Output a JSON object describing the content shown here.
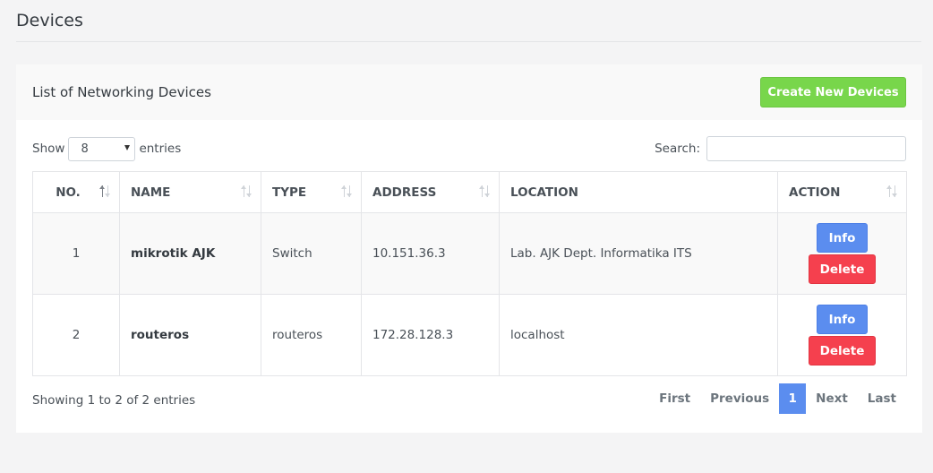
{
  "page": {
    "title": "Devices"
  },
  "card": {
    "title": "List of Networking Devices",
    "create_button": "Create New Devices"
  },
  "controls": {
    "show_label": "Show",
    "entries_value": "8",
    "entries_label": "entries",
    "search_label": "Search:",
    "search_value": ""
  },
  "table": {
    "headers": [
      "NO.",
      "NAME",
      "TYPE",
      "ADDRESS",
      "LOCATION",
      "ACTION"
    ],
    "rows": [
      {
        "no": "1",
        "name": "mikrotik AJK",
        "type": "Switch",
        "address": "10.151.36.3",
        "location": "Lab. AJK Dept. Informatika ITS"
      },
      {
        "no": "2",
        "name": "routeros",
        "type": "routeros",
        "address": "172.28.128.3",
        "location": "localhost"
      }
    ],
    "info_label": "Info",
    "delete_label": "Delete"
  },
  "footer": {
    "info": "Showing 1 to 2 of 2 entries",
    "pagination": {
      "first": "First",
      "previous": "Previous",
      "current": "1",
      "next": "Next",
      "last": "Last"
    }
  },
  "colors": {
    "create_button": "#78d64b",
    "info_button": "#5b8def",
    "delete_button": "#f5404e",
    "active_page": "#5b8def"
  }
}
